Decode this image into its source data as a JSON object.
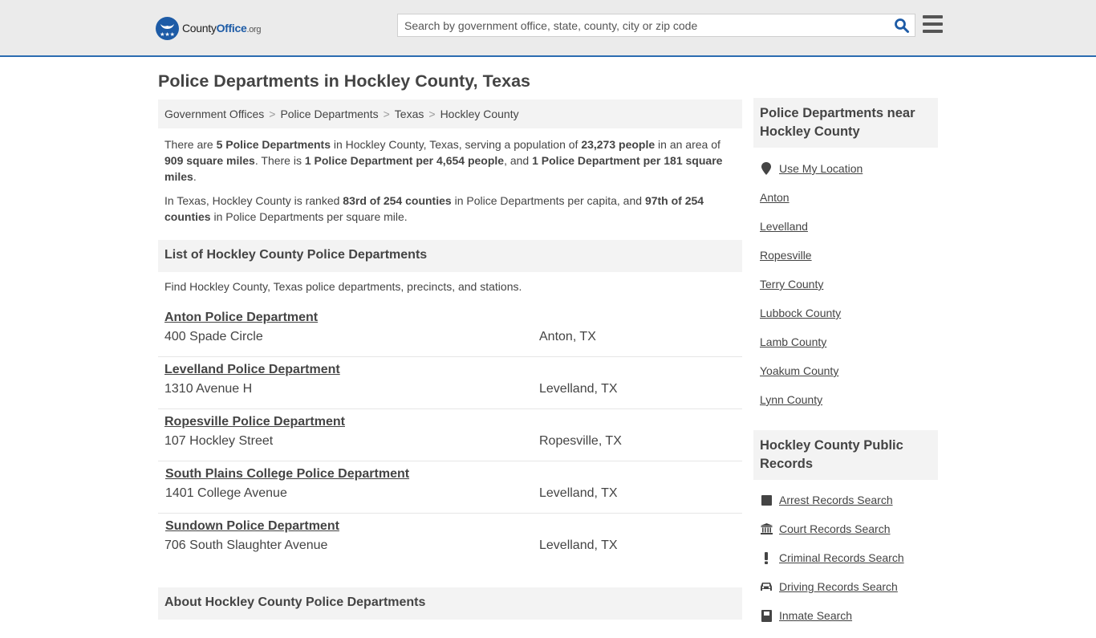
{
  "header": {
    "logo": {
      "brand_main": "County",
      "brand_accent": "Office",
      "brand_tld": ".org"
    },
    "search_placeholder": "Search by government office, state, county, city or zip code",
    "search_value": ""
  },
  "page_title": "Police Departments in Hockley County, Texas",
  "breadcrumb": [
    "Government Offices",
    "Police Departments",
    "Texas",
    "Hockley County"
  ],
  "intro": {
    "p1": {
      "t1": "There are ",
      "b1": "5 Police Departments",
      "t2": " in Hockley County, Texas, serving a population of ",
      "b2": "23,273 people",
      "t3": " in an area of ",
      "b3": "909 square miles",
      "t4": ". There is ",
      "b4": "1 Police Department per 4,654 people",
      "t5": ", and ",
      "b5": "1 Police Department per 181 square miles",
      "t6": "."
    },
    "p2": {
      "t1": "In Texas, Hockley County is ranked ",
      "b1": "83rd of 254 counties",
      "t2": " in Police Departments per capita, and ",
      "b2": "97th of 254 counties",
      "t3": " in Police Departments per square mile."
    }
  },
  "list_section": {
    "heading": "List of Hockley County Police Departments",
    "description": "Find Hockley County, Texas police departments, precincts, and stations.",
    "items": [
      {
        "name": "Anton Police Department",
        "address": "400 Spade Circle",
        "city": "Anton, TX"
      },
      {
        "name": "Levelland Police Department",
        "address": "1310 Avenue H",
        "city": "Levelland, TX"
      },
      {
        "name": "Ropesville Police Department",
        "address": "107 Hockley Street",
        "city": "Ropesville, TX"
      },
      {
        "name": "South Plains College Police Department",
        "address": "1401 College Avenue",
        "city": "Levelland, TX"
      },
      {
        "name": "Sundown Police Department",
        "address": "706 South Slaughter Avenue",
        "city": "Levelland, TX"
      }
    ]
  },
  "about_section": {
    "heading": "About Hockley County Police Departments"
  },
  "sidebar": {
    "nearby": {
      "heading": "Police Departments near Hockley County",
      "use_location": "Use My Location",
      "links": [
        "Anton",
        "Levelland",
        "Ropesville",
        "Terry County",
        "Lubbock County",
        "Lamb County",
        "Yoakum County",
        "Lynn County"
      ]
    },
    "records": {
      "heading": "Hockley County Public Records",
      "links": [
        {
          "label": "Arrest Records Search",
          "icon": "square-icon"
        },
        {
          "label": "Court Records Search",
          "icon": "courthouse-icon"
        },
        {
          "label": "Criminal Records Search",
          "icon": "exclamation-icon"
        },
        {
          "label": "Driving Records Search",
          "icon": "car-icon"
        },
        {
          "label": "Inmate Search",
          "icon": "inmate-icon"
        }
      ]
    }
  }
}
